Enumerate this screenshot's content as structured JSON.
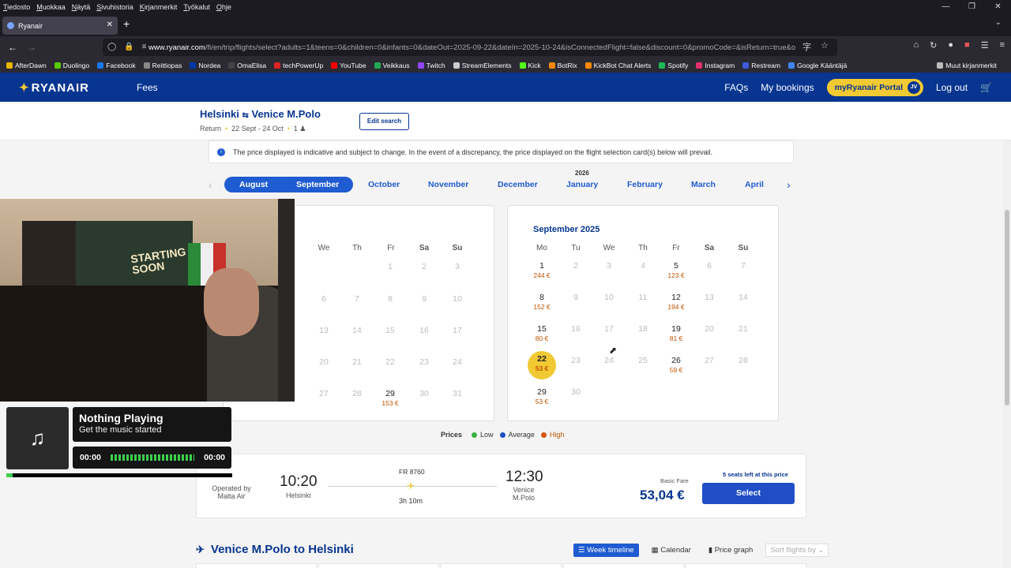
{
  "os_menu": [
    "Tiedosto",
    "Muokkaa",
    "Näytä",
    "Sivuhistoria",
    "Kirjanmerkit",
    "Työkalut",
    "Ohje"
  ],
  "browser": {
    "tab_title": "Ryanair",
    "url_domain": "www.ryanair.com",
    "url_rest": "/fi/en/trip/flights/select?adults=1&teens=0&children=0&infants=0&dateOut=2025-09-22&dateIn=2025-10-24&isConnectedFlight=false&discount=0&promoCode=&isReturn=true&o",
    "bookmarks": [
      "AfterDawn",
      "Duolingo",
      "Facebook",
      "Reittiopas",
      "Nordea",
      "OmaElisa",
      "techPowerUp",
      "YouTube",
      "Veikkaus",
      "Twitch",
      "StreamElements",
      "Kick",
      "BotRix",
      "KickBot Chat Alerts",
      "Spotify",
      "Instagram",
      "Restream",
      "Google Kääntäjä"
    ],
    "bookmarks_other": "Muut kirjanmerkit"
  },
  "header": {
    "logo": "RYANAIR",
    "fees": "Fees",
    "faqs": "FAQs",
    "bookings": "My bookings",
    "portal": "myRyanair Portal",
    "initials": "JV",
    "logout": "Log out"
  },
  "trip": {
    "origin": "Helsinki",
    "destination": "Venice M.Polo",
    "type": "Return",
    "dates": "22 Sept - 24 Oct",
    "pax": "1",
    "edit": "Edit search"
  },
  "notice": "The price displayed is indicative and subject to change. In the event of a discrepancy, the price displayed on the flight selection card(s) below will prevail.",
  "months": {
    "year_label": "2026",
    "items": [
      "August",
      "September",
      "October",
      "November",
      "December",
      "January",
      "February",
      "March",
      "April"
    ]
  },
  "calendar_left": {
    "weekdays_visible": [
      "We",
      "Th",
      "Fr",
      "Sa",
      "Su"
    ],
    "days": [
      "1",
      "2",
      "3",
      "6",
      "7",
      "8",
      "9",
      "10",
      "13",
      "14",
      "15",
      "16",
      "17",
      "20",
      "21",
      "22",
      "23",
      "24",
      "27",
      "28",
      "29",
      "30",
      "31"
    ],
    "price_29": "153 €"
  },
  "calendar_right": {
    "title": "September 2025",
    "weekdays": [
      "Mo",
      "Tu",
      "We",
      "Th",
      "Fr",
      "Sa",
      "Su"
    ],
    "prices": {
      "d1": "244 €",
      "d5": "123 €",
      "d8": "152 €",
      "d12": "194 €",
      "d15": "80 €",
      "d19": "81 €",
      "d22": "53 €",
      "d26": "59 €",
      "d29": "53 €"
    }
  },
  "legend": {
    "title": "Prices",
    "low": "Low",
    "average": "Average",
    "high": "High",
    "colors": {
      "low": "#3cb043",
      "average": "#1f4ec7",
      "high": "#d35400"
    }
  },
  "flight": {
    "operated_label": "Operated by",
    "operator": "Malta Air",
    "dep_time": "10:20",
    "dep_city": "Helsinki",
    "flight_no": "FR 8760",
    "duration": "3h 10m",
    "arr_time": "12:30",
    "arr_city_1": "Venice",
    "arr_city_2": "M.Polo",
    "seats_left": "5 seats left at this price",
    "fare_label": "Basic Fare",
    "price": "53,04 €",
    "select": "Select"
  },
  "return_section": {
    "title": "Venice M.Polo to Helsinki",
    "week_timeline": "Week timeline",
    "calendar": "Calendar",
    "price_graph": "Price graph",
    "sort": "Sort flights by"
  },
  "webcam": {
    "poster_text": "STARTING SOON"
  },
  "music": {
    "track": "Nothing Playing",
    "artist": "Get the music started",
    "time_elapsed": "00:00",
    "time_total": "00:00",
    "progress": 0.0
  }
}
